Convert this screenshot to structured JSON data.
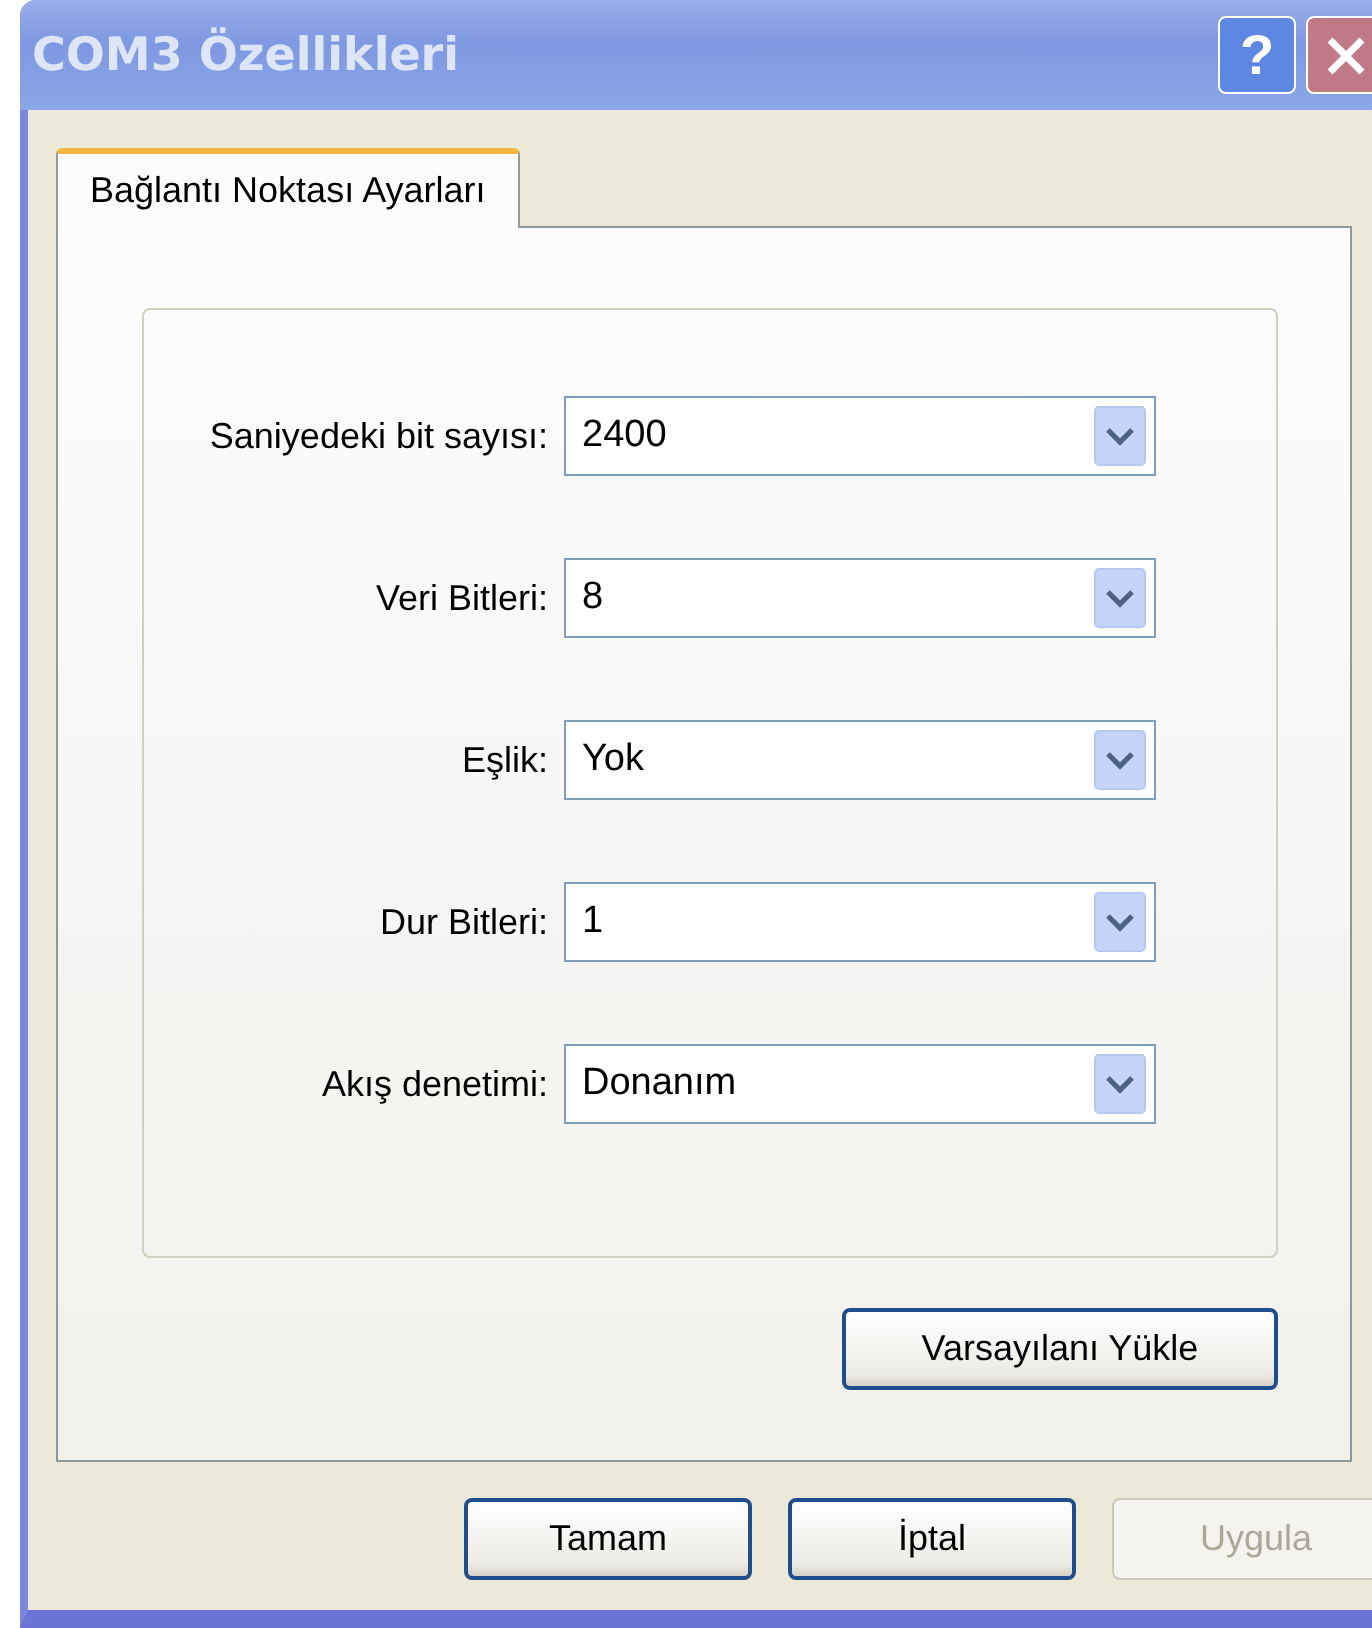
{
  "window": {
    "title": "COM3 Özellikleri",
    "help_button": "?"
  },
  "tabs": [
    {
      "label": "Bağlantı Noktası Ayarları",
      "selected": true
    }
  ],
  "fields": [
    {
      "label": "Saniyedeki bit sayısı:",
      "value": "2400"
    },
    {
      "label": "Veri Bitleri:",
      "value": "8"
    },
    {
      "label": "Eşlik:",
      "value": "Yok"
    },
    {
      "label": "Dur Bitleri:",
      "value": "1"
    },
    {
      "label": "Akış denetimi:",
      "value": "Donanım"
    }
  ],
  "defaults_button": "Varsayılanı Yükle",
  "buttons": [
    {
      "label": "Tamam",
      "disabled": false
    },
    {
      "label": "İptal",
      "disabled": false
    },
    {
      "label": "Uygula",
      "disabled": true
    }
  ]
}
